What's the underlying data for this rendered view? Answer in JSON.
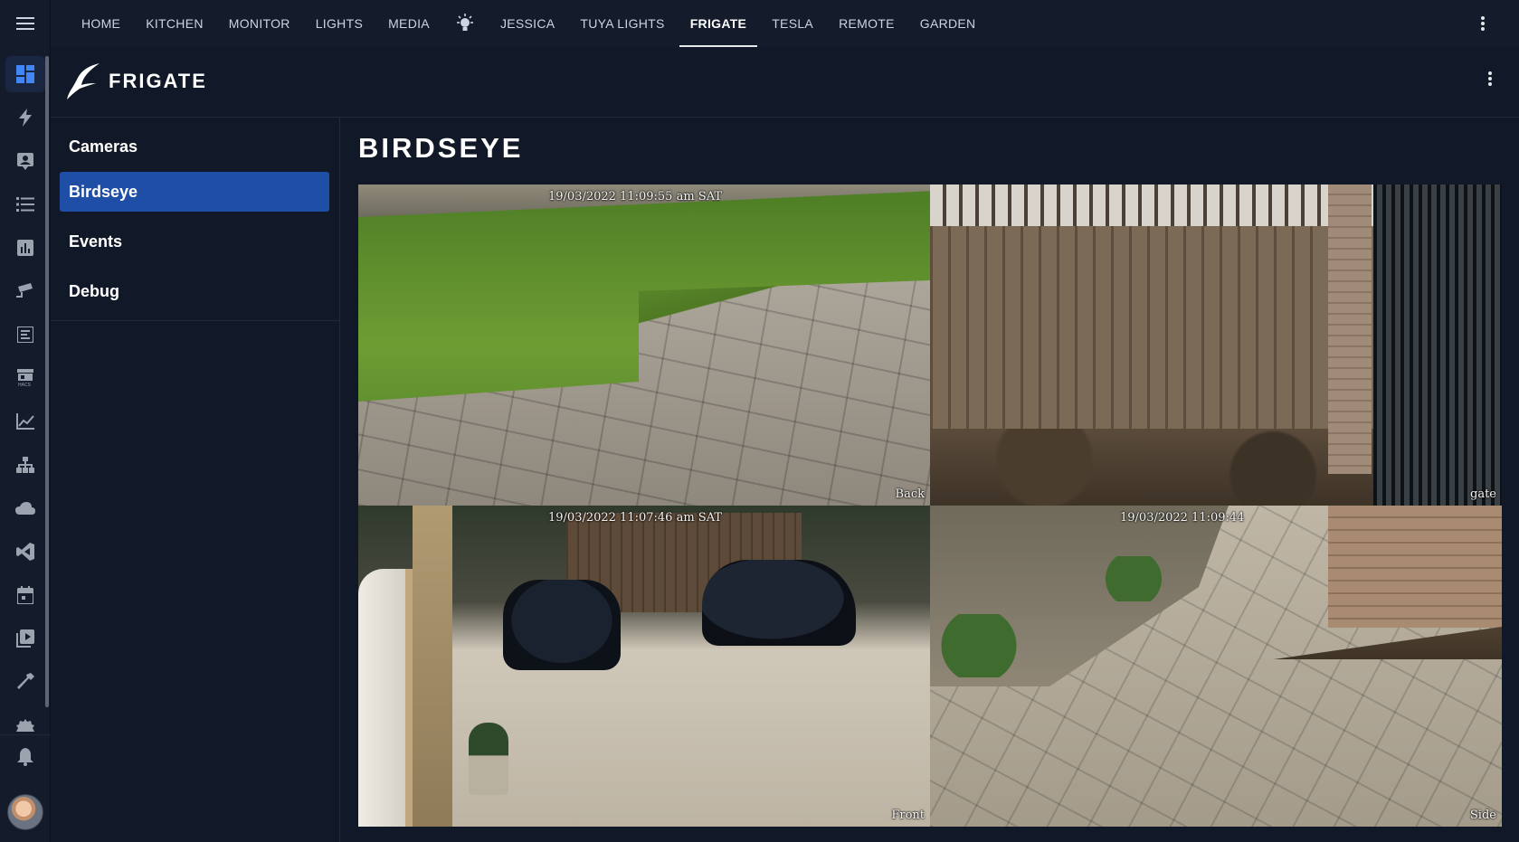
{
  "topbar": {
    "tabs": [
      {
        "label": "HOME"
      },
      {
        "label": "KITCHEN"
      },
      {
        "label": "MONITOR"
      },
      {
        "label": "LIGHTS"
      },
      {
        "label": "MEDIA"
      },
      {
        "label": "",
        "icon": "lightbulb-icon"
      },
      {
        "label": "JESSICA"
      },
      {
        "label": "TUYA LIGHTS"
      },
      {
        "label": "FRIGATE",
        "active": true
      },
      {
        "label": "TESLA"
      },
      {
        "label": "REMOTE"
      },
      {
        "label": "GARDEN"
      }
    ]
  },
  "rail": {
    "icons": [
      "dashboard-icon",
      "energy-icon",
      "person-card-icon",
      "list-icon",
      "bar-chart-icon",
      "cctv-icon",
      "logbook-icon",
      "hacs-store-icon",
      "history-chart-icon",
      "hierarchy-icon",
      "cloud-icon",
      "vscode-icon",
      "calendar-icon",
      "media-icon",
      "hammer-icon",
      "settings-icon"
    ],
    "active_index": 0
  },
  "frigate": {
    "brand": "FRIGATE",
    "nav": [
      {
        "label": "Cameras"
      },
      {
        "label": "Birdseye",
        "active": true
      },
      {
        "label": "Events"
      },
      {
        "label": "Debug"
      }
    ]
  },
  "main": {
    "title": "BIRDSEYE",
    "cameras": [
      {
        "name": "Back",
        "label": "Back",
        "timestamp": "19/03/2022 11:09:55 am SAT"
      },
      {
        "name": "gate",
        "label": "gate",
        "timestamp": ""
      },
      {
        "name": "Front",
        "label": "Front",
        "timestamp": "19/03/2022 11:07:46 am SAT"
      },
      {
        "name": "Side",
        "label": "Side",
        "timestamp": "19/03/2022 11:09:44"
      }
    ]
  },
  "colors": {
    "background": "#111827",
    "bar": "#141b2b",
    "nav_active": "#1e4ea6",
    "rail_active": "#4285f4"
  }
}
